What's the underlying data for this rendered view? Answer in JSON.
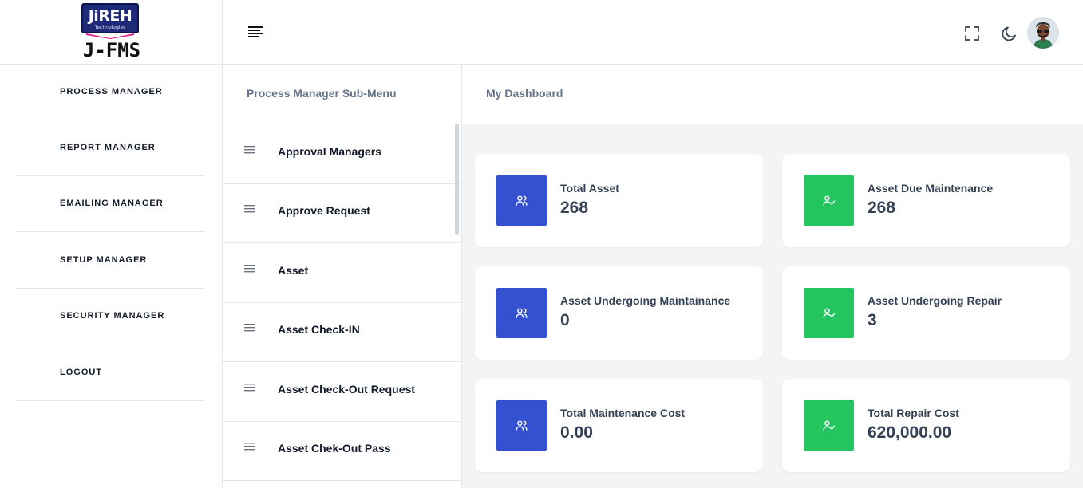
{
  "brand": {
    "logo_text": "JiREH",
    "logo_subtext": "Technologies",
    "app_name": "J-FMS"
  },
  "header": {
    "menu_icon": "hamburger-icon",
    "fullscreen_icon": "fullscreen-icon",
    "darkmode_icon": "moon-icon",
    "avatar_icon": "user-avatar"
  },
  "sidebar": {
    "items": [
      {
        "label": "PROCESS MANAGER"
      },
      {
        "label": "REPORT MANAGER"
      },
      {
        "label": "EMAILING MANAGER"
      },
      {
        "label": "SETUP MANAGER"
      },
      {
        "label": "SECURITY MANAGER"
      },
      {
        "label": "LOGOUT"
      }
    ]
  },
  "submenu": {
    "title": "Process Manager Sub-Menu",
    "items": [
      {
        "label": "Approval Managers"
      },
      {
        "label": "Approve Request"
      },
      {
        "label": "Asset"
      },
      {
        "label": "Asset Check-IN"
      },
      {
        "label": "Asset Check-Out Request"
      },
      {
        "label": "Asset Chek-Out Pass"
      }
    ]
  },
  "dashboard": {
    "title": "My Dashboard",
    "colors": {
      "blue_tile": "#3551d1",
      "green_tile": "#22c55e"
    },
    "cards": [
      {
        "label": "Total Asset",
        "value": "268",
        "icon": "users-icon"
      },
      {
        "label": "Asset Due Maintenance",
        "value": "268",
        "icon": "user-check-icon"
      },
      {
        "label": "Asset Undergoing Maintainance",
        "value": "0",
        "icon": "users-icon"
      },
      {
        "label": "Asset Undergoing Repair",
        "value": "3",
        "icon": "user-check-icon"
      },
      {
        "label": "Total Maintenance Cost",
        "value": "0.00",
        "icon": "users-icon"
      },
      {
        "label": "Total Repair Cost",
        "value": "620,000.00",
        "icon": "user-check-icon"
      }
    ]
  }
}
